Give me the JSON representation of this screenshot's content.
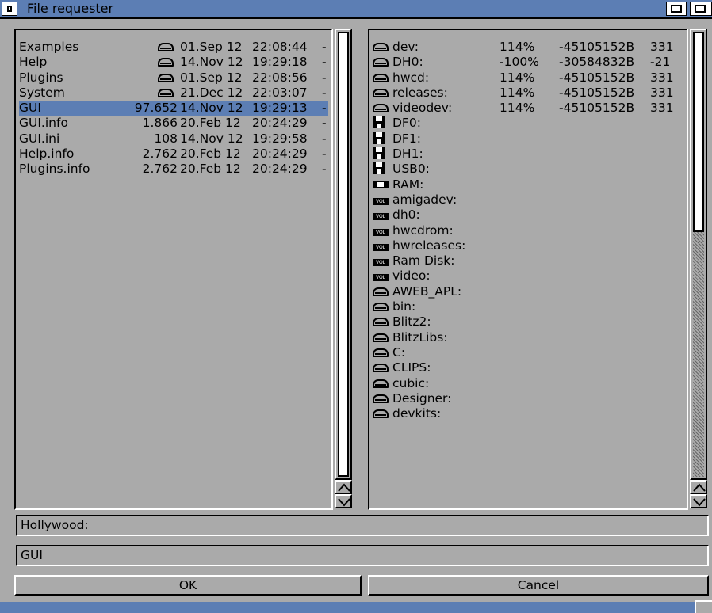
{
  "window": {
    "title": "File requester"
  },
  "files": [
    {
      "name": "Examples",
      "size": "",
      "is_dir": true,
      "date": "01.Sep 12",
      "time": "22:08:44",
      "flags": "-",
      "selected": false
    },
    {
      "name": "Help",
      "size": "",
      "is_dir": true,
      "date": "14.Nov 12",
      "time": "19:29:18",
      "flags": "-",
      "selected": false
    },
    {
      "name": "Plugins",
      "size": "",
      "is_dir": true,
      "date": "01.Sep 12",
      "time": "22:08:56",
      "flags": "-",
      "selected": false
    },
    {
      "name": "System",
      "size": "",
      "is_dir": true,
      "date": "21.Dec 12",
      "time": "22:03:07",
      "flags": "-",
      "selected": false
    },
    {
      "name": "GUI",
      "size": "97.652",
      "is_dir": false,
      "date": "14.Nov 12",
      "time": "19:29:13",
      "flags": "-",
      "selected": true
    },
    {
      "name": "GUI.info",
      "size": "1.866",
      "is_dir": false,
      "date": "20.Feb 12",
      "time": "20:24:29",
      "flags": "-",
      "selected": false
    },
    {
      "name": "GUI.ini",
      "size": "108",
      "is_dir": false,
      "date": "14.Nov 12",
      "time": "19:29:58",
      "flags": "-",
      "selected": false
    },
    {
      "name": "Help.info",
      "size": "2.762",
      "is_dir": false,
      "date": "20.Feb 12",
      "time": "20:24:29",
      "flags": "-",
      "selected": false
    },
    {
      "name": "Plugins.info",
      "size": "2.762",
      "is_dir": false,
      "date": "20.Feb 12",
      "time": "20:24:29",
      "flags": "-",
      "selected": false
    }
  ],
  "devices": [
    {
      "icon": "harddisk-icon",
      "name": "dev:",
      "pct": "114%",
      "free": "-45105152B",
      "blocks": "331"
    },
    {
      "icon": "harddisk-icon",
      "name": "DH0:",
      "pct": "-100%",
      "free": "-30584832B",
      "blocks": "-21"
    },
    {
      "icon": "harddisk-icon",
      "name": "hwcd:",
      "pct": "114%",
      "free": "-45105152B",
      "blocks": "331"
    },
    {
      "icon": "harddisk-icon",
      "name": "releases:",
      "pct": "114%",
      "free": "-45105152B",
      "blocks": "331"
    },
    {
      "icon": "harddisk-icon",
      "name": "videodev:",
      "pct": "114%",
      "free": "-45105152B",
      "blocks": "331"
    },
    {
      "icon": "floppy-icon",
      "name": "DF0:",
      "pct": "",
      "free": "",
      "blocks": ""
    },
    {
      "icon": "floppy-icon",
      "name": "DF1:",
      "pct": "",
      "free": "",
      "blocks": ""
    },
    {
      "icon": "floppy-icon",
      "name": "DH1:",
      "pct": "",
      "free": "",
      "blocks": ""
    },
    {
      "icon": "floppy-icon",
      "name": "USB0:",
      "pct": "",
      "free": "",
      "blocks": ""
    },
    {
      "icon": "ram-icon",
      "name": "RAM:",
      "pct": "",
      "free": "",
      "blocks": ""
    },
    {
      "icon": "volume-icon",
      "name": "amigadev:",
      "pct": "",
      "free": "",
      "blocks": ""
    },
    {
      "icon": "volume-icon",
      "name": "dh0:",
      "pct": "",
      "free": "",
      "blocks": ""
    },
    {
      "icon": "volume-icon",
      "name": "hwcdrom:",
      "pct": "",
      "free": "",
      "blocks": ""
    },
    {
      "icon": "volume-icon",
      "name": "hwreleases:",
      "pct": "",
      "free": "",
      "blocks": ""
    },
    {
      "icon": "volume-icon",
      "name": "Ram Disk:",
      "pct": "",
      "free": "",
      "blocks": ""
    },
    {
      "icon": "volume-icon",
      "name": "video:",
      "pct": "",
      "free": "",
      "blocks": ""
    },
    {
      "icon": "harddisk-icon",
      "name": "AWEB_APL:",
      "pct": "",
      "free": "",
      "blocks": ""
    },
    {
      "icon": "harddisk-icon",
      "name": "bin:",
      "pct": "",
      "free": "",
      "blocks": ""
    },
    {
      "icon": "harddisk-icon",
      "name": "Blitz2:",
      "pct": "",
      "free": "",
      "blocks": ""
    },
    {
      "icon": "harddisk-icon",
      "name": "BlitzLibs:",
      "pct": "",
      "free": "",
      "blocks": ""
    },
    {
      "icon": "harddisk-icon",
      "name": "C:",
      "pct": "",
      "free": "",
      "blocks": ""
    },
    {
      "icon": "harddisk-icon",
      "name": "CLIPS:",
      "pct": "",
      "free": "",
      "blocks": ""
    },
    {
      "icon": "harddisk-icon",
      "name": "cubic:",
      "pct": "",
      "free": "",
      "blocks": ""
    },
    {
      "icon": "harddisk-icon",
      "name": "Designer:",
      "pct": "",
      "free": "",
      "blocks": ""
    },
    {
      "icon": "harddisk-icon",
      "name": "devkits:",
      "pct": "",
      "free": "",
      "blocks": ""
    }
  ],
  "volume_icon_text": "VOL",
  "path_field": {
    "value": "Hollywood:"
  },
  "file_field": {
    "value": "GUI"
  },
  "buttons": {
    "ok": "OK",
    "cancel": "Cancel"
  },
  "scroll": {
    "files_visible_fraction": 1.0,
    "devices_visible_fraction": 0.45
  },
  "colors": {
    "title_bar": "#5c7eb4",
    "selection": "#5c7eb4",
    "background": "#aaaaaa"
  }
}
